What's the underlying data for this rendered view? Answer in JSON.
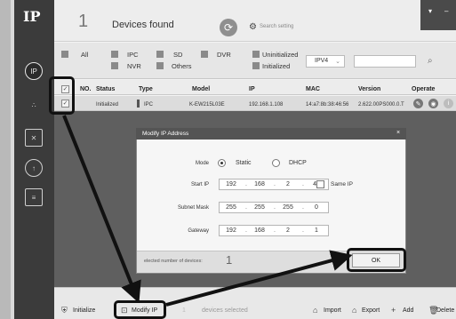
{
  "app": {
    "logo": "IP",
    "found_count": "1",
    "found_label": "Devices found",
    "search_setting": "Search setting"
  },
  "window": {
    "menu_glyph": "▾",
    "minimize_glyph": "–"
  },
  "sidebar": {
    "icons": [
      "IP",
      "∴",
      "✕",
      "↑",
      "≡"
    ]
  },
  "filters": {
    "all": "All",
    "ipc": "IPC",
    "sd": "SD",
    "dvr": "DVR",
    "nvr": "NVR",
    "others": "Others",
    "uninitialized": "Uninitialized",
    "initialized": "Initialized",
    "ip_version": "IPV4"
  },
  "table": {
    "headers": {
      "no": "NO.",
      "status": "Status",
      "type": "Type",
      "model": "Model",
      "ip": "IP",
      "mac": "MAC",
      "version": "Version",
      "operate": "Operate"
    },
    "rows": [
      {
        "status": "Initialized",
        "type": "IPC",
        "model": "K-EW215L03E",
        "ip": "192.168.1.108",
        "mac": "14:a7:8b:38:46:56",
        "version": "2.622.00PS000.0.T"
      }
    ]
  },
  "dialog": {
    "title": "Modify IP Address",
    "close": "×",
    "mode_label": "Mode",
    "mode_static": "Static",
    "mode_dhcp": "DHCP",
    "mode_selected": "Static",
    "start_ip_label": "Start IP",
    "start_ip": [
      "192",
      "168",
      "2",
      "40"
    ],
    "same_ip_label": "Same IP",
    "subnet_label": "Subnet Mask",
    "subnet": [
      "255",
      "255",
      "255",
      "0"
    ],
    "gateway_label": "Gateway",
    "gateway": [
      "192",
      "168",
      "2",
      "1"
    ],
    "selected_label": "elected number of devices:",
    "selected_count": "1",
    "ok": "OK"
  },
  "bottom": {
    "initialize": "Initialize",
    "modify_ip": "Modify IP",
    "selected_count": "1",
    "selected_text": "devices selected",
    "import": "Import",
    "export": "Export",
    "add": "Add",
    "delete": "Delete"
  }
}
